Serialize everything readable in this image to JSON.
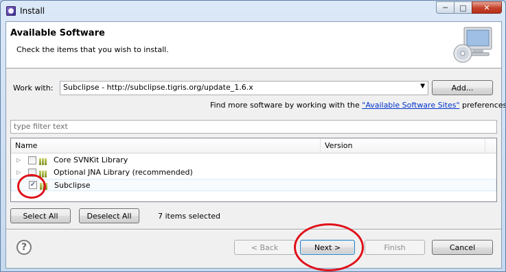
{
  "window": {
    "title": "Install",
    "min_icon": "minimize-icon",
    "max_icon": "maximize-icon",
    "close_icon": "close-icon"
  },
  "header": {
    "title": "Available Software",
    "subtitle": "Check the items that you wish to install."
  },
  "work_with": {
    "label": "Work with:",
    "value": "Subclipse - http://subclipse.tigris.org/update_1.6.x",
    "add_button": "Add...",
    "find_more_prefix": "Find more software by working with the",
    "sites_link": "\"Available Software Sites\"",
    "find_more_suffix": "preferences."
  },
  "filter": {
    "placeholder": "type filter text"
  },
  "tree": {
    "columns": [
      "Name",
      "Version"
    ],
    "rows": [
      {
        "label": "Core SVNKit Library",
        "checked": false,
        "expandable": true
      },
      {
        "label": "Optional JNA Library (recommended)",
        "checked": false,
        "expandable": true
      },
      {
        "label": "Subclipse",
        "checked": true,
        "expandable": false
      }
    ]
  },
  "selection": {
    "select_all": "Select All",
    "deselect_all": "Deselect All",
    "status": "7 items selected"
  },
  "footer": {
    "back": "< Back",
    "next": "Next >",
    "finish": "Finish",
    "cancel": "Cancel",
    "help_icon": "help-icon"
  },
  "colors": {
    "annotation": "#e0101a",
    "link": "#0033cc",
    "titlebar": "#c5d9ef"
  }
}
